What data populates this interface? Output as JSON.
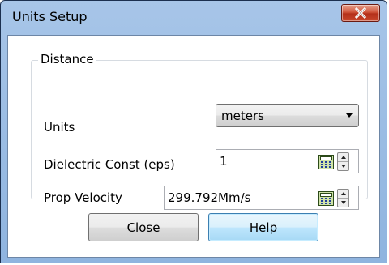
{
  "window": {
    "title": "Units Setup",
    "close_glyph": "X"
  },
  "group": {
    "legend": "Distance"
  },
  "units": {
    "label": "Units",
    "selected": "meters",
    "arrow_icon": "chevron-down-icon"
  },
  "dielectric": {
    "label": "Dielectric Const (eps)",
    "value": "1",
    "calculator_icon": "calculator-icon"
  },
  "velocity": {
    "label": "Prop Velocity",
    "value": "299.792Mm/s",
    "calculator_icon": "calculator-icon"
  },
  "buttons": {
    "close": "Close",
    "help": "Help"
  },
  "colors": {
    "title_bar": "#9dbfe6",
    "close_button": "#c7472c",
    "help_button_focus": "#bee6fd"
  }
}
